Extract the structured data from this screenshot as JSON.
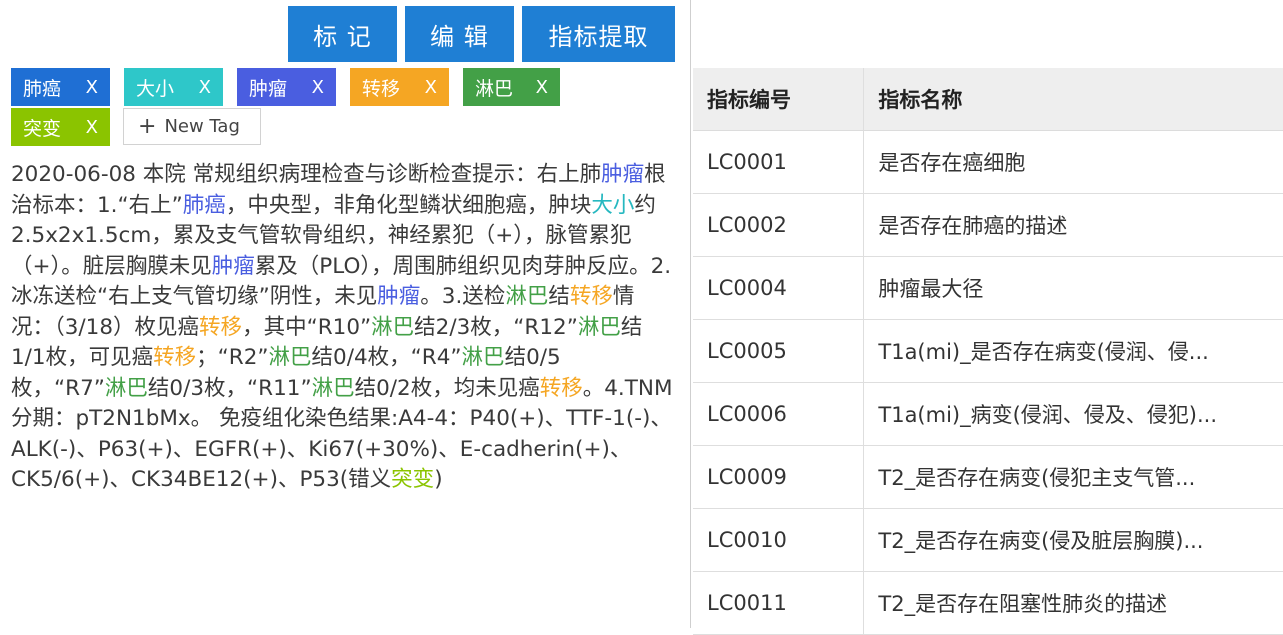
{
  "toolbar": {
    "mark_label": "标 记",
    "edit_label": "编 辑",
    "extract_label": "指标提取"
  },
  "tags": [
    {
      "label": "肺癌",
      "close": "X",
      "color": "#1f6fd4"
    },
    {
      "label": "大小",
      "close": "X",
      "color": "#2ec7c9"
    },
    {
      "label": "肿瘤",
      "close": "X",
      "color": "#4a5ee0"
    },
    {
      "label": "转移",
      "close": "X",
      "color": "#f5a623"
    },
    {
      "label": "淋巴",
      "close": "X",
      "color": "#43a047"
    },
    {
      "label": "突变",
      "close": "X",
      "color": "#8bc400"
    }
  ],
  "new_tag_label": "New Tag",
  "report": {
    "segments": [
      {
        "t": "2020-06-08 本院 常规组织病理检查与诊断检查提示：右上肺"
      },
      {
        "t": "肿瘤",
        "c": "blue"
      },
      {
        "t": "根治标本：1.“右上”"
      },
      {
        "t": "肺癌",
        "c": "blue"
      },
      {
        "t": "，中央型，非角化型鳞状细胞癌，肿块"
      },
      {
        "t": "大小",
        "c": "teal"
      },
      {
        "t": "约2.5x2x1.5cm，累及支气管软骨组织，神经累犯（+），脉管累犯（+）。脏层胸膜未见"
      },
      {
        "t": "肿瘤",
        "c": "blue"
      },
      {
        "t": "累及（PLO），周围肺组织见肉芽肿反应。2.冰冻送检“右上支气管切缘”阴性，未见"
      },
      {
        "t": "肿瘤",
        "c": "blue"
      },
      {
        "t": "。3.送检"
      },
      {
        "t": "淋巴",
        "c": "green"
      },
      {
        "t": "结"
      },
      {
        "t": "转移",
        "c": "orange"
      },
      {
        "t": "情况：（3/18）枚见癌"
      },
      {
        "t": "转移",
        "c": "orange"
      },
      {
        "t": "，其中“R10”"
      },
      {
        "t": "淋巴",
        "c": "green"
      },
      {
        "t": "结2/3枚，“R12”"
      },
      {
        "t": "淋巴",
        "c": "green"
      },
      {
        "t": "结1/1枚，可见癌"
      },
      {
        "t": "转移",
        "c": "orange"
      },
      {
        "t": "；“R2”"
      },
      {
        "t": "淋巴",
        "c": "green"
      },
      {
        "t": "结0/4枚，“R4”"
      },
      {
        "t": "淋巴",
        "c": "green"
      },
      {
        "t": "结0/5枚，“R7”"
      },
      {
        "t": "淋巴",
        "c": "green"
      },
      {
        "t": "结0/3枚，“R11”"
      },
      {
        "t": "淋巴",
        "c": "green"
      },
      {
        "t": "结0/2枚，均未见癌"
      },
      {
        "t": "转移",
        "c": "orange"
      },
      {
        "t": "。4.TNM分期：pT2N1bMx。 免疫组化染色结果:A4-4：P40(+)、TTF-1(-)、ALK(-)、P63(+)、EGFR(+)、Ki67(+30%)、E-cadherin(+)、CK5/6(+)、CK34BE12(+)、P53(错义"
      },
      {
        "t": "突变",
        "c": "lime"
      },
      {
        "t": ")"
      }
    ]
  },
  "table": {
    "headers": [
      "指标编号",
      "指标名称"
    ],
    "rows": [
      {
        "id": "LC0001",
        "name": "是否存在癌细胞"
      },
      {
        "id": "LC0002",
        "name": "是否存在肺癌的描述"
      },
      {
        "id": "LC0004",
        "name": "肿瘤最大径"
      },
      {
        "id": "LC0005",
        "name": "T1a(mi)_是否存在病变(侵润、侵..."
      },
      {
        "id": "LC0006",
        "name": "T1a(mi)_病变(侵润、侵及、侵犯)..."
      },
      {
        "id": "LC0009",
        "name": "T2_是否存在病变(侵犯主支气管..."
      },
      {
        "id": "LC0010",
        "name": "T2_是否存在病变(侵及脏层胸膜)..."
      },
      {
        "id": "LC0011",
        "name": "T2_是否存在阻塞性肺炎的描述"
      }
    ]
  }
}
